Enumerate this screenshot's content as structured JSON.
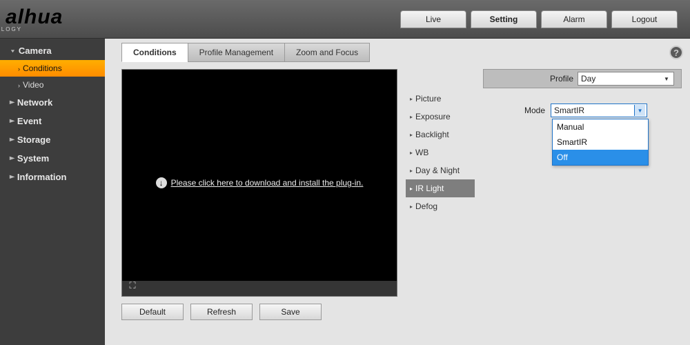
{
  "brand": {
    "name": "alhua",
    "sub": "TECHNOLOGY"
  },
  "topTabs": [
    {
      "label": "Live",
      "active": false
    },
    {
      "label": "Setting",
      "active": true
    },
    {
      "label": "Alarm",
      "active": false
    },
    {
      "label": "Logout",
      "active": false
    }
  ],
  "sidebar": {
    "groups": [
      {
        "label": "Camera",
        "open": true,
        "items": [
          {
            "label": "Conditions",
            "active": true
          },
          {
            "label": "Video",
            "active": false
          }
        ]
      },
      {
        "label": "Network",
        "open": false
      },
      {
        "label": "Event",
        "open": false
      },
      {
        "label": "Storage",
        "open": false
      },
      {
        "label": "System",
        "open": false
      },
      {
        "label": "Information",
        "open": false
      }
    ]
  },
  "subtabs": [
    {
      "label": "Conditions",
      "active": true
    },
    {
      "label": "Profile Management",
      "active": false
    },
    {
      "label": "Zoom and Focus",
      "active": false
    }
  ],
  "preview": {
    "plugin_text": "Please click here to download and install the plug-in."
  },
  "categories": [
    {
      "label": "Picture"
    },
    {
      "label": "Exposure"
    },
    {
      "label": "Backlight"
    },
    {
      "label": "WB"
    },
    {
      "label": "Day & Night"
    },
    {
      "label": "IR Light",
      "active": true
    },
    {
      "label": "Defog"
    }
  ],
  "profile": {
    "label": "Profile",
    "value": "Day"
  },
  "mode": {
    "label": "Mode",
    "value": "SmartIR",
    "options": [
      "Manual",
      "SmartIR",
      "Off"
    ],
    "highlight": "Off"
  },
  "buttons": {
    "default": "Default",
    "refresh": "Refresh",
    "save": "Save"
  }
}
